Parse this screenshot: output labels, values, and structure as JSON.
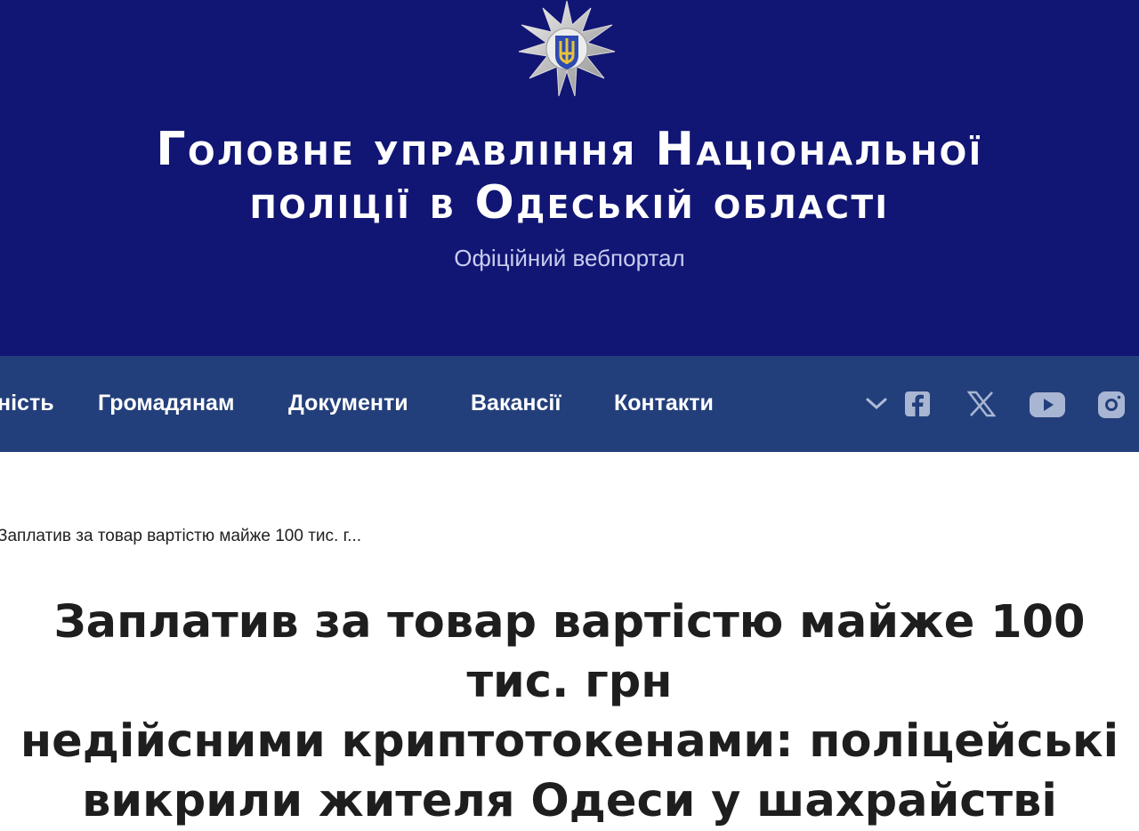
{
  "header": {
    "title_line1": "Головне управління Національної",
    "title_line2": "поліції в Одеській області",
    "subtitle": "Офіційний вебпортал",
    "emblem_icon": "police-star-emblem-icon"
  },
  "nav": {
    "items": [
      {
        "label": "ність"
      },
      {
        "label": "Громадянам"
      },
      {
        "label": "Документи"
      },
      {
        "label": "Вакансії"
      },
      {
        "label": "Контакти"
      }
    ],
    "more_icon": "chevron-down-icon",
    "social": [
      "facebook-icon",
      "x-icon",
      "youtube-icon",
      "instagram-icon"
    ]
  },
  "breadcrumb": {
    "current": "Заплатив за товар вартістю майже 100 тис. г..."
  },
  "article": {
    "title_line1": "Заплатив за товар вартістю майже 100 тис. грн",
    "title_line2": "недійсними криптотокенами: поліцейські",
    "title_line3": "викрили жителя Одеси у шахрайстві"
  },
  "colors": {
    "header_bg": "#111574",
    "nav_bg": "#233f7b",
    "emblem_gold": "#e7c33a",
    "emblem_blue": "#2d4bb3"
  }
}
